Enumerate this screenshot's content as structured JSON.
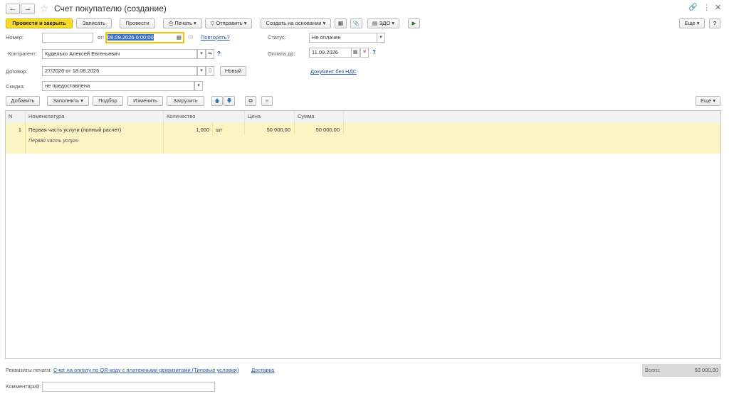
{
  "window": {
    "title": "Счет покупателю (создание)"
  },
  "toolbar": {
    "post_close": "Провести и закрыть",
    "save": "Записать",
    "post": "Провести",
    "print": "Печать",
    "send": "Отправить",
    "create_based": "Создать на основании",
    "edo": "ЭДО",
    "more": "Еще",
    "help": "?"
  },
  "form": {
    "number_label": "Номер:",
    "number_value": "",
    "from_label": "от:",
    "date_value": "08.09.2026  0:00:00",
    "repeat_link": "Повторять?",
    "status_label": "Статус:",
    "status_value": "Не оплачен",
    "contractor_label": "Контрагент:",
    "contractor_value": "Куделько Алексей Евгеньевич",
    "pay_until_label": "Оплата до:",
    "pay_until_value": "11.09.2026",
    "contract_label": "Договор:",
    "contract_value": "27/2026 от 18.08.2026",
    "new_button": "Новый",
    "vat_link": "Документ без НДС",
    "discount_label": "Скидка:",
    "discount_value": "не предоставлена"
  },
  "table_toolbar": {
    "add": "Добавить",
    "fill": "Заполнить",
    "select": "Подбор",
    "change": "Изменить",
    "load": "Загрузить",
    "more": "Еще"
  },
  "table": {
    "columns": [
      "N",
      "Номенклатура",
      "Количество",
      "Цена",
      "Сумма"
    ],
    "rows": [
      {
        "n": "1",
        "name": "Первая часть услуги (полный расчет)",
        "description": "Первая часть услуги",
        "quantity": "1,000",
        "unit": "шт",
        "price": "50 000,00",
        "sum": "50 000,00"
      }
    ]
  },
  "footer": {
    "print_requisites_label": "Реквизиты печати:",
    "print_link": "Счет на оплату по QR-коду с платежными реквизитами (Типовые условия)",
    "delivery_link": "Доставка",
    "total_label": "Всего:",
    "total_value": "50 000,00",
    "comment_label": "Комментарий:",
    "comment_value": ""
  },
  "colors": {
    "primary_button": "#f7d82c",
    "selected_row": "#fcf4c4",
    "link": "#2a56a6",
    "date_highlight": "#3b70c7"
  },
  "icons": [
    "back-arrow-icon",
    "forward-arrow-icon",
    "star-icon",
    "link-icon",
    "more-vert-icon",
    "close-icon",
    "printer-icon",
    "send-icon",
    "structure-icon",
    "paperclip-icon",
    "edo-icon",
    "run-icon",
    "calendar-icon",
    "arrow-up-icon",
    "arrow-down-icon"
  ]
}
